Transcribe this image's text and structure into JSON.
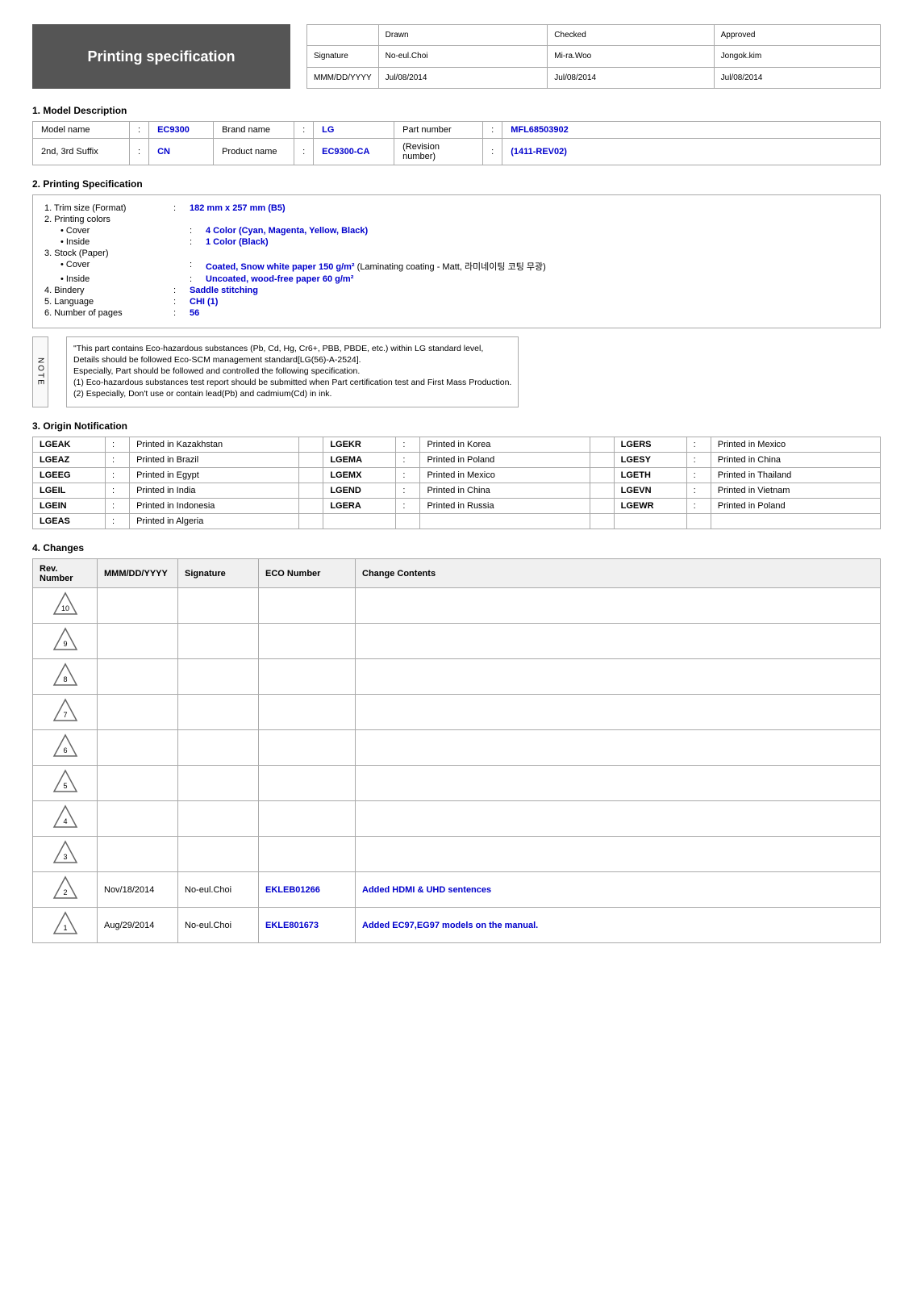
{
  "header": {
    "title": "Printing specification",
    "approval": {
      "columns": [
        "",
        "Drawn",
        "Checked",
        "Approved"
      ],
      "rows": [
        [
          "Signature",
          "No-eul.Choi",
          "Mi-ra.Woo",
          "Jongok.kim"
        ],
        [
          "MMM/DD/YYYY",
          "Jul/08/2014",
          "Jul/08/2014",
          "Jul/08/2014"
        ]
      ]
    }
  },
  "section1": {
    "title": "1. Model Description",
    "rows": [
      {
        "col1_label": "Model name",
        "col1_value": "EC9300",
        "col2_label": "Brand name",
        "col2_value": "LG",
        "col3_label": "Part number",
        "col3_value": "MFL68503902"
      },
      {
        "col1_label": "2nd, 3rd Suffix",
        "col1_value": "CN",
        "col2_label": "Product name",
        "col2_value": "EC9300-CA",
        "col3_label": "(Revision number)",
        "col3_value": "(1411-REV02)"
      }
    ]
  },
  "section2": {
    "title": "2. Printing Specification",
    "items": [
      {
        "label": "1. Trim size (Format)",
        "value": "182 mm x 257 mm (B5)",
        "indent": 0
      },
      {
        "label": "2. Printing colors",
        "value": "",
        "indent": 0
      },
      {
        "label": "• Cover",
        "value": "4 Color (Cyan, Magenta, Yellow, Black)",
        "indent": 1
      },
      {
        "label": "• Inside",
        "value": "1 Color (Black)",
        "indent": 1
      },
      {
        "label": "3. Stock (Paper)",
        "value": "",
        "indent": 0
      },
      {
        "label": "• Cover",
        "value": "Coated, Snow white paper 150 g/m²",
        "value2": "(Laminating coating - Matt, 라미네이팅 코팅 무광)",
        "indent": 1
      },
      {
        "label": "• Inside",
        "value": "Uncoated, wood-free paper 60 g/m²",
        "indent": 1
      },
      {
        "label": "4. Bindery",
        "value": "Saddle stitching",
        "indent": 0
      },
      {
        "label": "5. Language",
        "value": "CHI (1)",
        "indent": 0
      },
      {
        "label": "6. Number of pages",
        "value": "56",
        "indent": 0
      }
    ],
    "note": {
      "side_label": "NOTE",
      "lines": [
        "\"This part contains Eco-hazardous substances (Pb, Cd, Hg, Cr6+, PBB, PBDE, etc.) within LG standard level,",
        "Details should be followed Eco-SCM management standard[LG(56)-A-2524].",
        "Especially, Part should be followed and controlled the following specification.",
        "(1) Eco-hazardous substances test report should be submitted when Part certification test and First Mass Production.",
        "(2) Especially, Don't use or contain lead(Pb) and cadmium(Cd) in ink."
      ]
    }
  },
  "section3": {
    "title": "3. Origin Notification",
    "entries": [
      {
        "code": "LGEAK",
        "country": "Printed in Kazakhstan",
        "code2": "LGEKR",
        "country2": "Printed in Korea",
        "code3": "LGERS",
        "country3": "Printed in Mexico"
      },
      {
        "code": "LGEAZ",
        "country": "Printed in Brazil",
        "code2": "LGEMA",
        "country2": "Printed in Poland",
        "code3": "LGESY",
        "country3": "Printed in China"
      },
      {
        "code": "LGEEG",
        "country": "Printed in Egypt",
        "code2": "LGEMX",
        "country2": "Printed in Mexico",
        "code3": "LGETH",
        "country3": "Printed in Thailand"
      },
      {
        "code": "LGEIL",
        "country": "Printed in India",
        "code2": "LGEND",
        "country2": "Printed in China",
        "code3": "LGEVN",
        "country3": "Printed in Vietnam"
      },
      {
        "code": "LGEIN",
        "country": "Printed in Indonesia",
        "code2": "LGERA",
        "country2": "Printed in Russia",
        "code3": "LGEWR",
        "country3": "Printed in Poland"
      },
      {
        "code": "LGEAS",
        "country": "Printed in Algeria",
        "code2": "",
        "country2": "",
        "code3": "",
        "country3": ""
      }
    ]
  },
  "section4": {
    "title": "4. Changes",
    "header": {
      "rev": "Rev. Number",
      "date": "MMM/DD/YYYY",
      "sig": "Signature",
      "eco": "ECO Number",
      "change": "Change Contents"
    },
    "rows": [
      {
        "rev": "10",
        "date": "",
        "sig": "",
        "eco": "",
        "change": "",
        "highlight": false
      },
      {
        "rev": "9",
        "date": "",
        "sig": "",
        "eco": "",
        "change": "",
        "highlight": false
      },
      {
        "rev": "8",
        "date": "",
        "sig": "",
        "eco": "",
        "change": "",
        "highlight": false
      },
      {
        "rev": "7",
        "date": "",
        "sig": "",
        "eco": "",
        "change": "",
        "highlight": false
      },
      {
        "rev": "6",
        "date": "",
        "sig": "",
        "eco": "",
        "change": "",
        "highlight": false
      },
      {
        "rev": "5",
        "date": "",
        "sig": "",
        "eco": "",
        "change": "",
        "highlight": false
      },
      {
        "rev": "4",
        "date": "",
        "sig": "",
        "eco": "",
        "change": "",
        "highlight": false
      },
      {
        "rev": "3",
        "date": "",
        "sig": "",
        "eco": "",
        "change": "",
        "highlight": false
      },
      {
        "rev": "2",
        "date": "Nov/18/2014",
        "sig": "No-eul.Choi",
        "eco": "EKLEB01266",
        "change": "Added HDMI & UHD sentences",
        "highlight": true
      },
      {
        "rev": "1",
        "date": "Aug/29/2014",
        "sig": "No-eul.Choi",
        "eco": "EKLE801673",
        "change": "Added EC97,EG97 models on the manual.",
        "highlight": true
      }
    ]
  }
}
